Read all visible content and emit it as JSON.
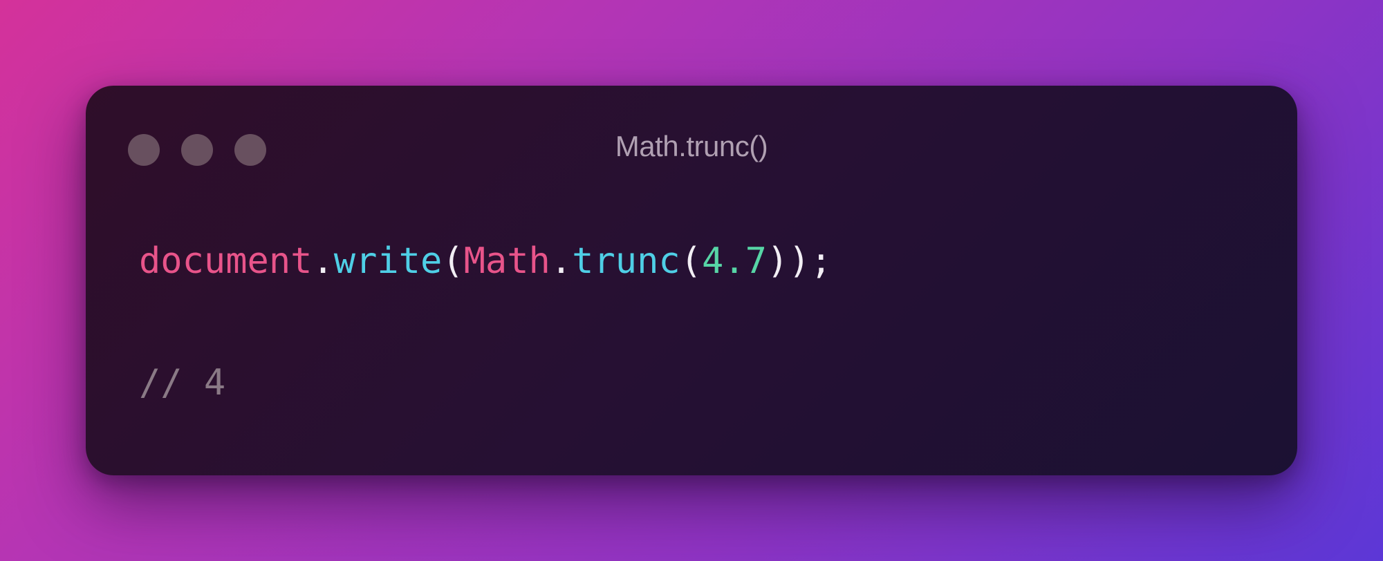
{
  "window": {
    "title": "Math.trunc()",
    "controls": [
      "window-dot",
      "window-dot",
      "window-dot"
    ]
  },
  "code": {
    "line1": {
      "object1": "document",
      "dot1": ".",
      "method1": "write",
      "paren_open1": "(",
      "object2": "Math",
      "dot2": ".",
      "method2": "trunc",
      "paren_open2": "(",
      "number": "4.7",
      "paren_close": "))",
      "semicolon": ";"
    },
    "line2": {
      "comment": "// 4"
    }
  },
  "colors": {
    "object": "#e8548a",
    "function": "#4fcfe6",
    "number": "#57d5a6",
    "punctuation": "#f2eef4",
    "comment": "#8a7a86",
    "title": "#b0a0b2",
    "window_dot": "#68505f"
  }
}
